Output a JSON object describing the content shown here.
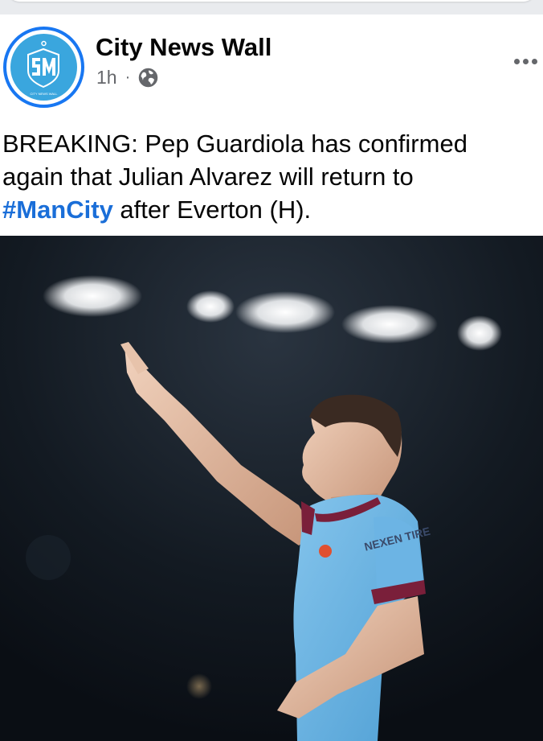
{
  "post": {
    "page_name": "City News Wall",
    "time": "1h",
    "separator": "·",
    "text_line1": "BREAKING: Pep Guardiola has confirmed",
    "text_line2": "again that Julian Alvarez will return to",
    "hashtag": "#ManCity",
    "text_line3_rest": " after Everton (H).",
    "avatar_text": "CITY NEWS WALL",
    "shirt_sponsor": "NEXEN TIRE",
    "icons": {
      "privacy": "globe-icon",
      "menu": "more-icon"
    },
    "colors": {
      "accent": "#1877f2",
      "avatar_bg": "#3aa6de",
      "hashtag": "#1a6ed8",
      "meta": "#65676b",
      "shirt": "#6cb4e4",
      "trim": "#7a1f3a"
    }
  }
}
